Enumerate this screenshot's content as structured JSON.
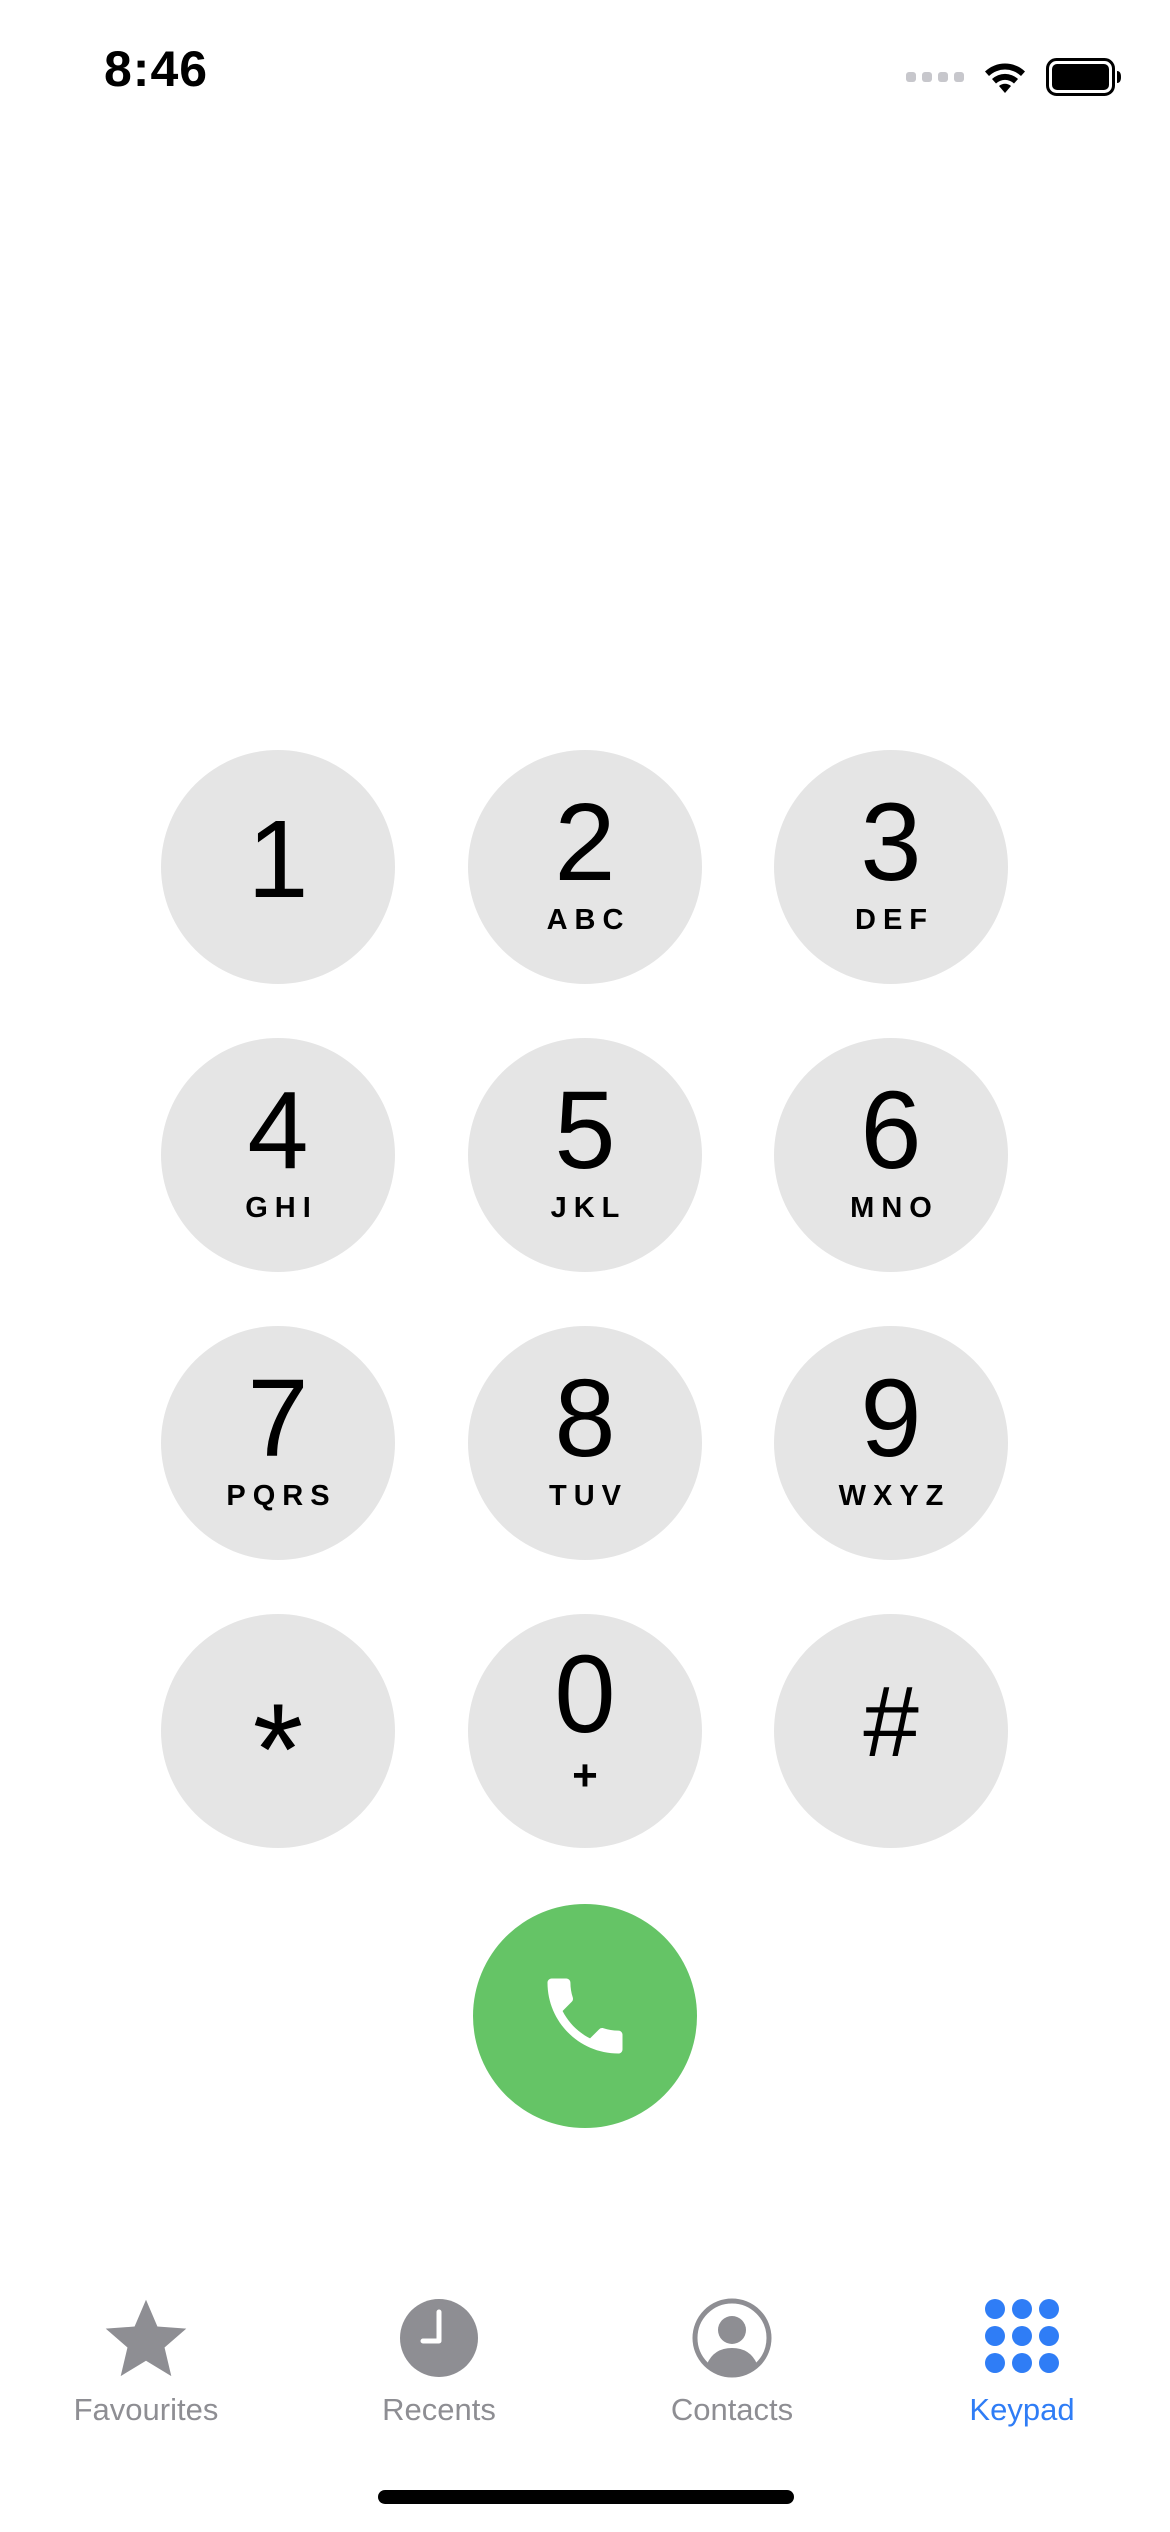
{
  "status_bar": {
    "time": "8:46",
    "signal_icon": "cellular-signal-icon",
    "wifi_icon": "wifi-icon",
    "battery_icon": "battery-icon"
  },
  "keypad": {
    "keys": [
      {
        "digit": "1",
        "letters": ""
      },
      {
        "digit": "2",
        "letters": "ABC"
      },
      {
        "digit": "3",
        "letters": "DEF"
      },
      {
        "digit": "4",
        "letters": "GHI"
      },
      {
        "digit": "5",
        "letters": "JKL"
      },
      {
        "digit": "6",
        "letters": "MNO"
      },
      {
        "digit": "7",
        "letters": "PQRS"
      },
      {
        "digit": "8",
        "letters": "TUV"
      },
      {
        "digit": "9",
        "letters": "WXYZ"
      },
      {
        "digit": "*",
        "letters": ""
      },
      {
        "digit": "0",
        "letters": "+"
      },
      {
        "digit": "#",
        "letters": ""
      }
    ],
    "call_icon": "phone-icon",
    "call_color": "#65c466",
    "key_color": "#e5e5e5"
  },
  "tab_bar": {
    "tabs": [
      {
        "label": "Favourites",
        "icon": "star-icon",
        "active": false
      },
      {
        "label": "Recents",
        "icon": "clock-icon",
        "active": false
      },
      {
        "label": "Contacts",
        "icon": "person-circle-icon",
        "active": false
      },
      {
        "label": "Keypad",
        "icon": "keypad-grid-icon",
        "active": true
      }
    ],
    "active_color": "#2f7df6",
    "inactive_color": "#8e8e93"
  }
}
